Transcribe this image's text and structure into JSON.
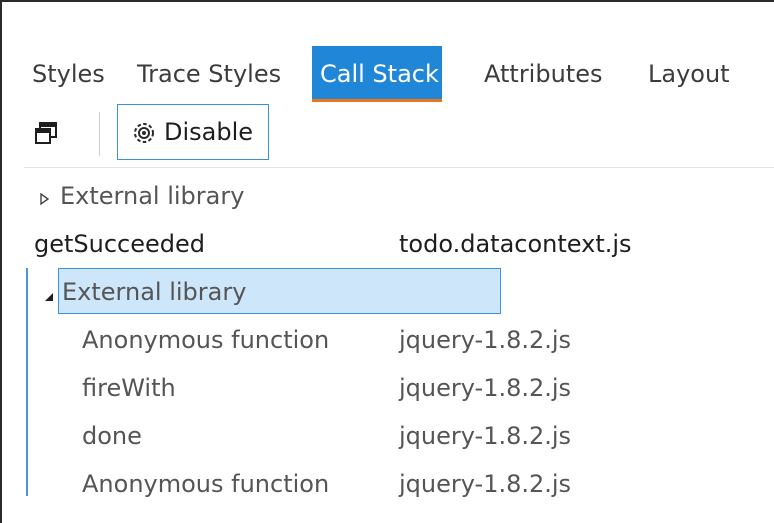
{
  "tabs": [
    {
      "label": "Styles",
      "active": false
    },
    {
      "label": "Trace Styles",
      "active": false
    },
    {
      "label": "Call Stack",
      "active": true
    },
    {
      "label": "Attributes",
      "active": false
    },
    {
      "label": "Layout",
      "active": false
    }
  ],
  "toolbar": {
    "expand_icon": "collapse-windows-icon",
    "disable_label": "Disable",
    "disable_icon": "gear-icon"
  },
  "colors": {
    "active_tab": "#1f86d8",
    "active_tab_underline": "#e8761c",
    "selection_bg": "#cde6fa",
    "selection_border": "#3a92e0"
  },
  "call_stack": [
    {
      "name": "External library",
      "file": "",
      "type": "group",
      "expanded": false
    },
    {
      "name": "getSucceeded",
      "file": "todo.datacontext.js",
      "type": "frame"
    },
    {
      "name": "External library",
      "file": "",
      "type": "group",
      "expanded": true,
      "selected": true
    },
    {
      "name": "Anonymous function",
      "file": "jquery-1.8.2.js",
      "type": "child"
    },
    {
      "name": "fireWith",
      "file": "jquery-1.8.2.js",
      "type": "child"
    },
    {
      "name": "done",
      "file": "jquery-1.8.2.js",
      "type": "child"
    },
    {
      "name": "Anonymous function",
      "file": "jquery-1.8.2.js",
      "type": "child"
    }
  ]
}
